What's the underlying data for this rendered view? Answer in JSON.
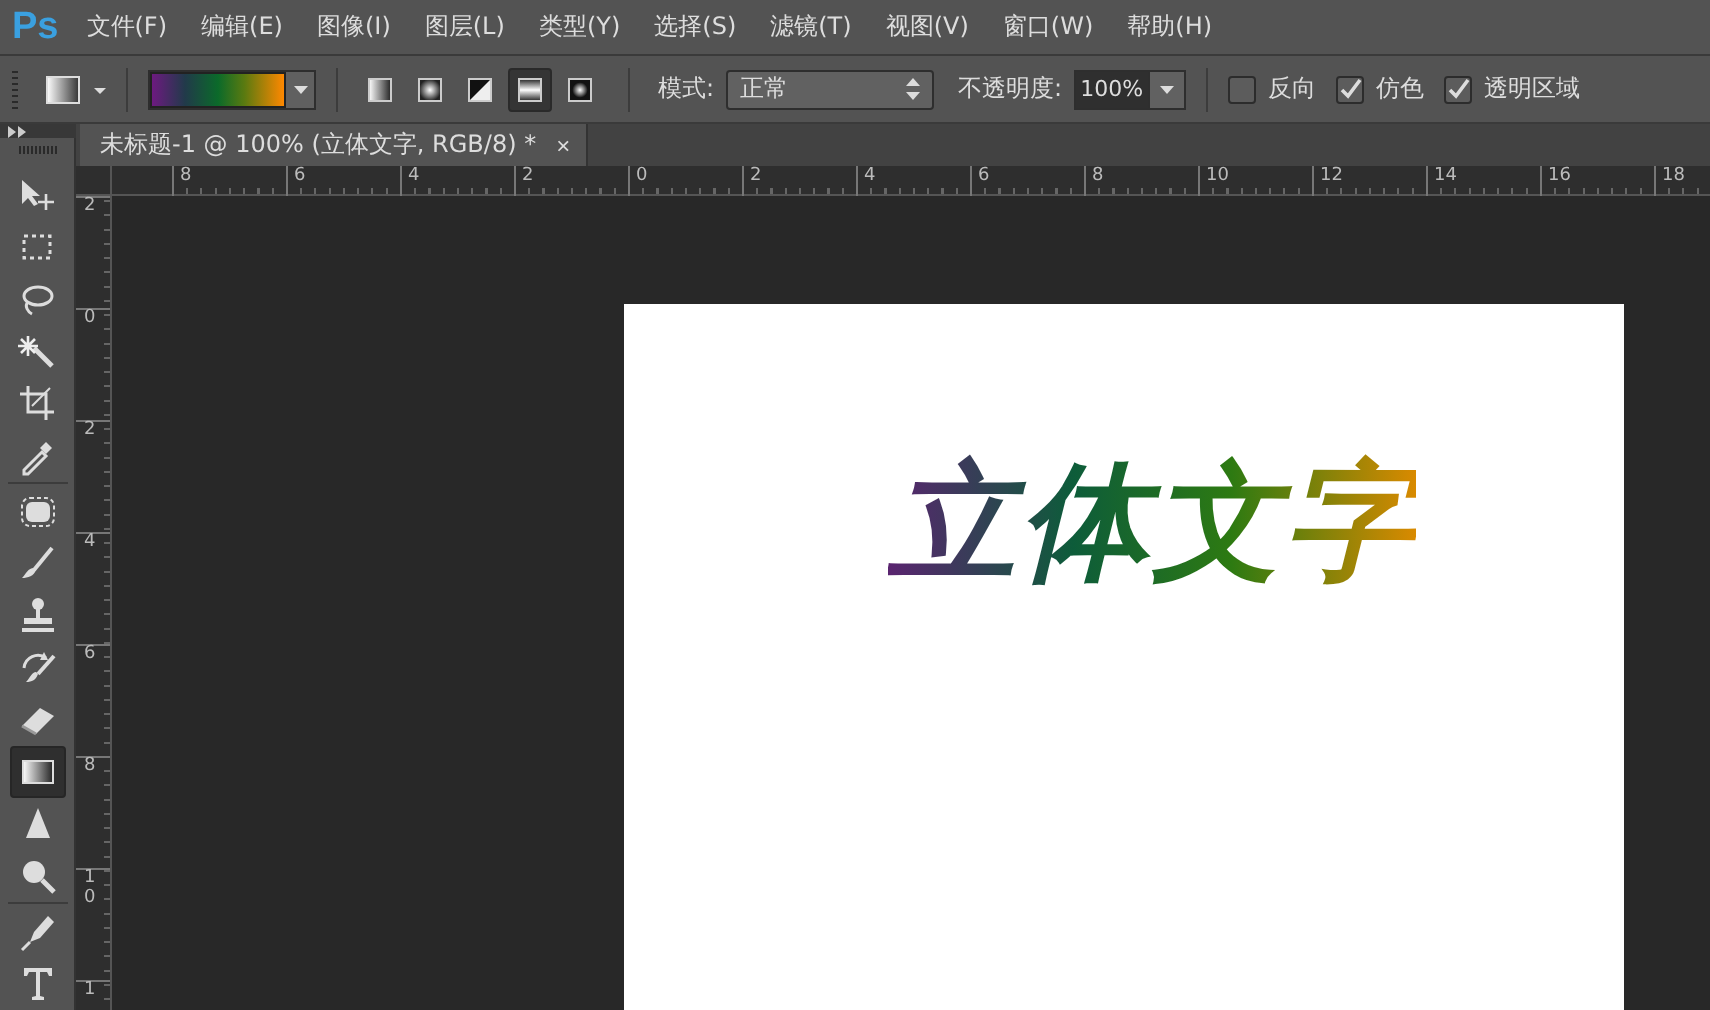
{
  "app": {
    "logo": "Ps"
  },
  "menu": [
    "文件(F)",
    "编辑(E)",
    "图像(I)",
    "图层(L)",
    "类型(Y)",
    "选择(S)",
    "滤镜(T)",
    "视图(V)",
    "窗口(W)",
    "帮助(H)"
  ],
  "options_bar": {
    "gradient_types": [
      {
        "kind": "linear",
        "selected": false
      },
      {
        "kind": "radial",
        "selected": false
      },
      {
        "kind": "angle",
        "selected": false
      },
      {
        "kind": "reflected",
        "selected": true
      },
      {
        "kind": "diamond",
        "selected": false
      }
    ],
    "mode": {
      "label": "模式:",
      "value": "正常"
    },
    "opacity": {
      "label": "不透明度:",
      "value": "100%"
    },
    "checkboxes": [
      {
        "label": "反向",
        "checked": false
      },
      {
        "label": "仿色",
        "checked": true
      },
      {
        "label": "透明区域",
        "checked": true
      }
    ]
  },
  "document_tab": {
    "title": "未标题-1 @ 100% (立体文字, RGB/8) *",
    "close": "×"
  },
  "tool_groups": [
    [
      {
        "kind": "move",
        "selected": false
      },
      {
        "kind": "marquee",
        "selected": false
      },
      {
        "kind": "lasso",
        "selected": false
      },
      {
        "kind": "wand",
        "selected": false
      },
      {
        "kind": "crop",
        "selected": false
      },
      {
        "kind": "eyedropper",
        "selected": false
      }
    ],
    [
      {
        "kind": "patch",
        "selected": false
      },
      {
        "kind": "brush",
        "selected": false
      },
      {
        "kind": "stamp",
        "selected": false
      },
      {
        "kind": "history",
        "selected": false
      },
      {
        "kind": "eraser",
        "selected": false
      },
      {
        "kind": "gradient",
        "selected": true
      },
      {
        "kind": "blur",
        "selected": false
      },
      {
        "kind": "dodge",
        "selected": false
      }
    ],
    [
      {
        "kind": "pen",
        "selected": false
      },
      {
        "kind": "type",
        "selected": false
      }
    ]
  ],
  "rulers": {
    "horizontal": [
      "8",
      "6",
      "4",
      "2",
      "0",
      "2",
      "4",
      "6",
      "8",
      "10",
      "12",
      "14",
      "16",
      "18"
    ],
    "vertical": [
      "2",
      "0",
      "2",
      "4",
      "6",
      "8",
      "10",
      "1"
    ]
  },
  "canvas": {
    "text": "立体文字"
  }
}
